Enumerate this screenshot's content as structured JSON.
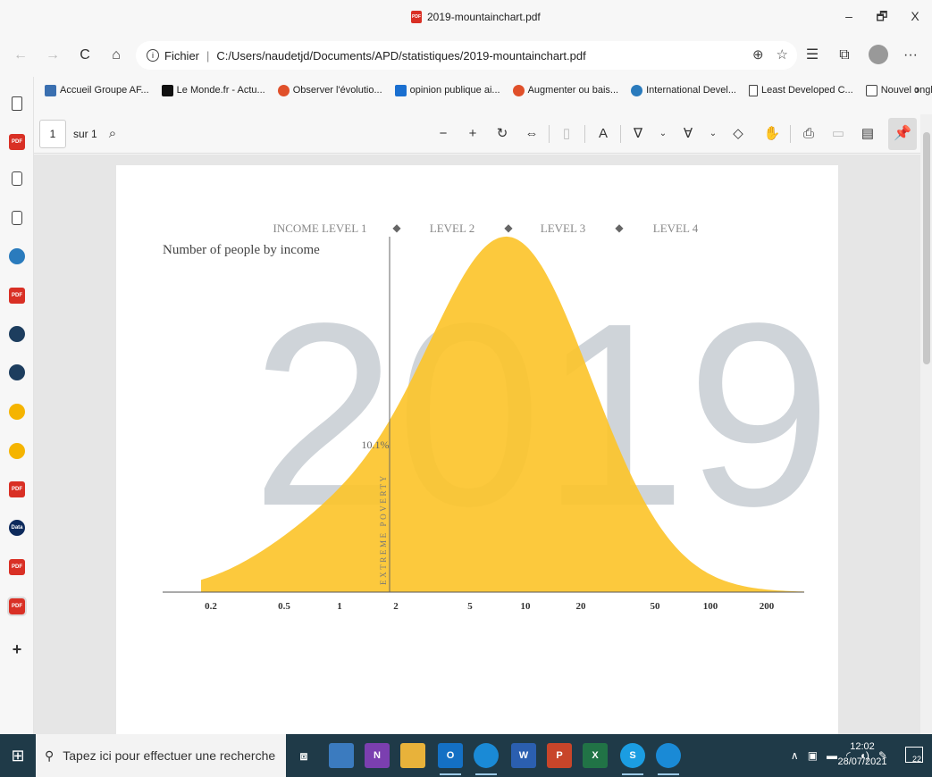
{
  "window": {
    "title": "2019-mountainchart.pdf",
    "controls": {
      "minimize": "–",
      "restore": "🗗",
      "close": "X"
    }
  },
  "nav": {
    "back": "←",
    "forward": "→",
    "refresh": "C",
    "home": "⌂",
    "address_scheme": "Fichier",
    "address_url": "C:/Users/naudetjd/Documents/APD/statistiques/2019-mountainchart.pdf",
    "more": "···"
  },
  "favorites": [
    {
      "label": "Accueil Groupe AF...",
      "color": "#3a6fb0"
    },
    {
      "label": "Le Monde.fr - Actu...",
      "color": "#111111"
    },
    {
      "label": "Observer l'évolutio...",
      "color": "#e0502a"
    },
    {
      "label": "opinion publique ai...",
      "color": "#1a6fd0"
    },
    {
      "label": "Augmenter ou bais...",
      "color": "#e0502a"
    },
    {
      "label": "International Devel...",
      "color": "#2a7bbd"
    },
    {
      "label": "Least Developed C...",
      "color": "#ffffff"
    },
    {
      "label": "Nouvel onglet",
      "color": "#ffffff"
    }
  ],
  "pdf_toolbar": {
    "page_number": "1",
    "page_of": "sur 1"
  },
  "mountain_chart": {
    "title": "Number of people by income",
    "levels": [
      "INCOME LEVEL 1",
      "LEVEL 2",
      "LEVEL 3",
      "LEVEL 4"
    ],
    "year_watermark": "2019",
    "extreme_poverty_label": "EXTREME POVERTY",
    "extreme_poverty_pct": "10.1%",
    "ticks": [
      "0.2",
      "0.5",
      "1",
      "2",
      "5",
      "10",
      "20",
      "50",
      "100",
      "200"
    ],
    "fill_color": "#fcc42c"
  },
  "taskbar": {
    "search_placeholder": "Tapez ici pour effectuer une recherche",
    "time": "12:02",
    "date": "28/07/2021",
    "notifications": "22"
  }
}
